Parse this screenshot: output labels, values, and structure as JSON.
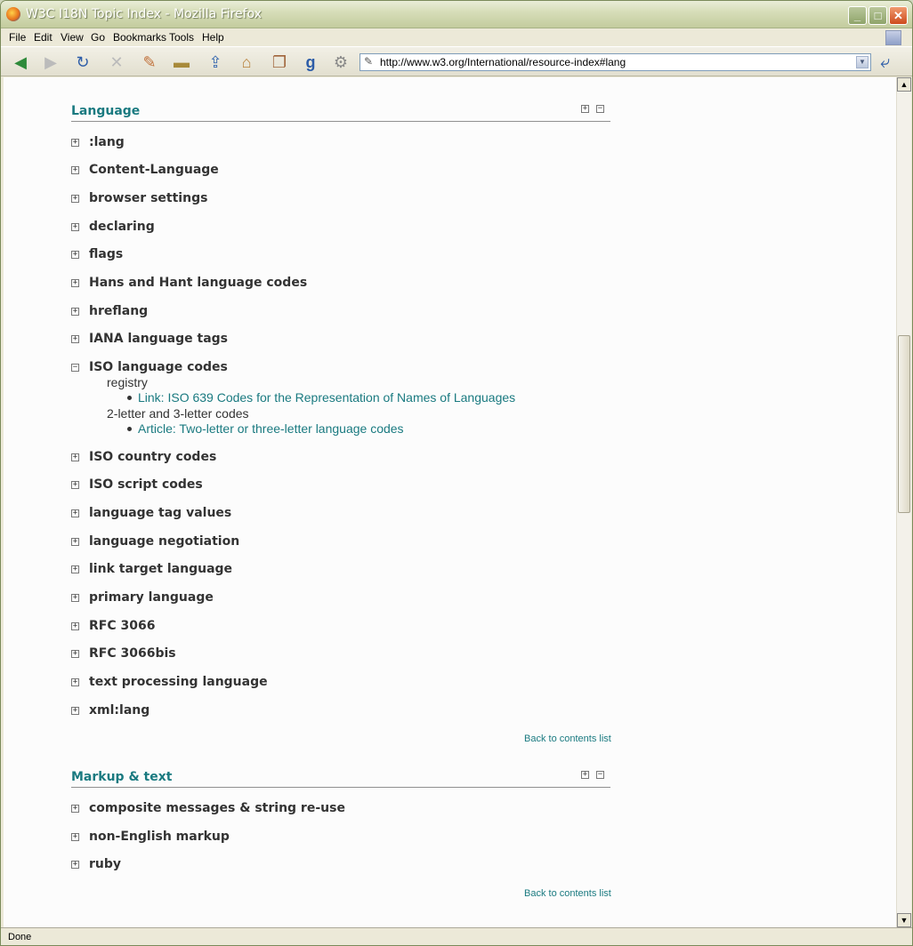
{
  "window": {
    "title": "W3C I18N Topic Index - Mozilla Firefox",
    "minimize": "_",
    "maximize": "□",
    "close": "✕"
  },
  "menubar": {
    "items": [
      "File",
      "Edit",
      "View",
      "Go",
      "Bookmarks",
      "Tools",
      "Help"
    ]
  },
  "toolbar": {
    "url": "http://www.w3.org/International/resource-index#lang",
    "icons": [
      "back-icon",
      "forward-icon",
      "reload-icon",
      "stop-icon",
      "bookmark-icon",
      "print-icon",
      "upload-icon",
      "home-icon",
      "history-icon",
      "google-icon",
      "settings-icon"
    ]
  },
  "sections": [
    {
      "title": "Language",
      "topics": [
        ":lang",
        "Content-Language",
        "browser settings",
        "declaring",
        "flags",
        "Hans and Hant language codes",
        "hreflang",
        "IANA language tags",
        "ISO language codes",
        "ISO country codes",
        "ISO script codes",
        "language tag values",
        "language negotiation",
        "link target language",
        "primary language",
        "RFC 3066",
        "RFC 3066bis",
        "text processing language",
        "xml:lang"
      ],
      "expanded": {
        "sub1": "registry",
        "link1": "Link: ISO 639 Codes for the Representation of Names of Languages",
        "sub2": "2-letter and 3-letter codes",
        "link2": "Article: Two-letter or three-letter language codes"
      },
      "back": "Back to contents list"
    },
    {
      "title": "Markup & text",
      "topics": [
        "composite messages & string re-use",
        "non-English markup",
        "ruby"
      ],
      "back": "Back to contents list"
    }
  ],
  "statusbar": {
    "text": "Done"
  }
}
